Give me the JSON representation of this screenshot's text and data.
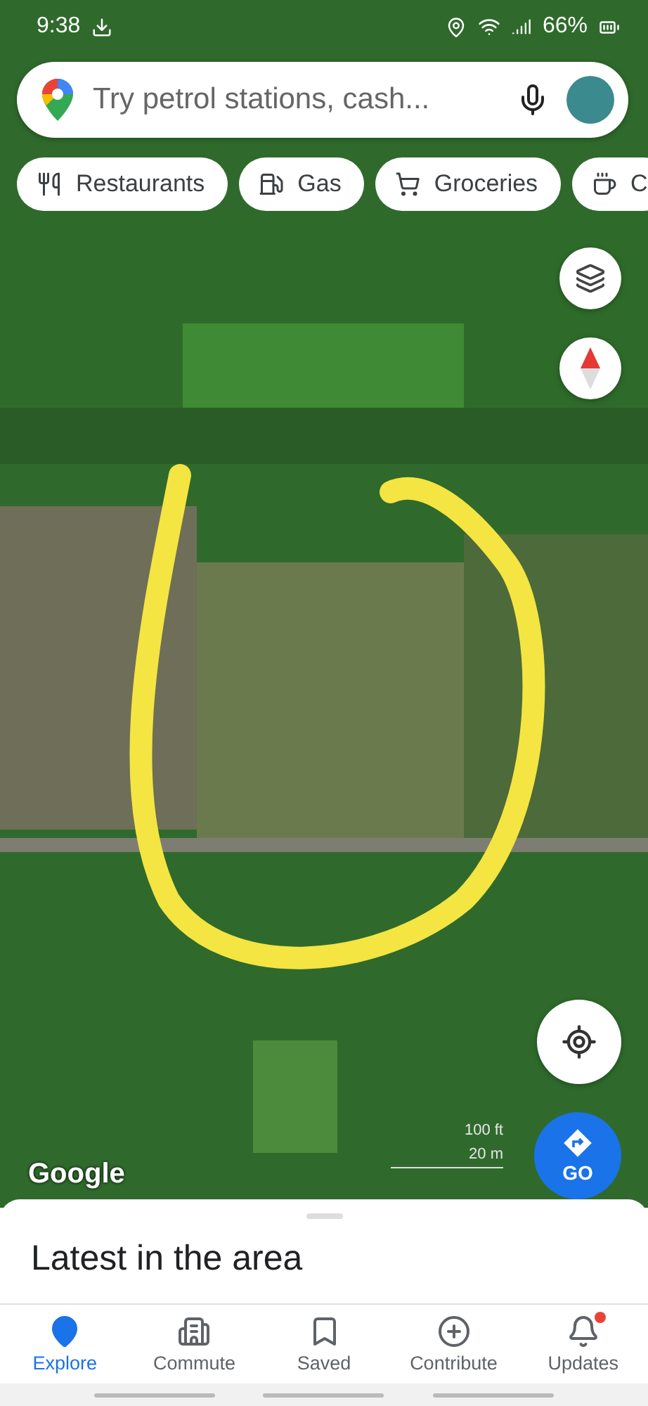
{
  "status_bar": {
    "time": "9:38",
    "battery": "66%"
  },
  "search": {
    "placeholder": "Try petrol stations, cash..."
  },
  "chips": [
    {
      "kind": "restaurant",
      "label": "Restaurants"
    },
    {
      "kind": "gas",
      "label": "Gas"
    },
    {
      "kind": "groceries",
      "label": "Groceries"
    },
    {
      "kind": "cafe",
      "label": "C"
    }
  ],
  "map": {
    "logo": "Google",
    "scale_imperial": "100 ft",
    "scale_metric": "20 m"
  },
  "go_button": {
    "label": "GO"
  },
  "sheet": {
    "title": "Latest in the area"
  },
  "nav": [
    {
      "kind": "explore",
      "label": "Explore",
      "selected": true,
      "badge": false
    },
    {
      "kind": "commute",
      "label": "Commute",
      "selected": false,
      "badge": false
    },
    {
      "kind": "saved",
      "label": "Saved",
      "selected": false,
      "badge": false
    },
    {
      "kind": "contribute",
      "label": "Contribute",
      "selected": false,
      "badge": false
    },
    {
      "kind": "updates",
      "label": "Updates",
      "selected": false,
      "badge": true
    }
  ]
}
